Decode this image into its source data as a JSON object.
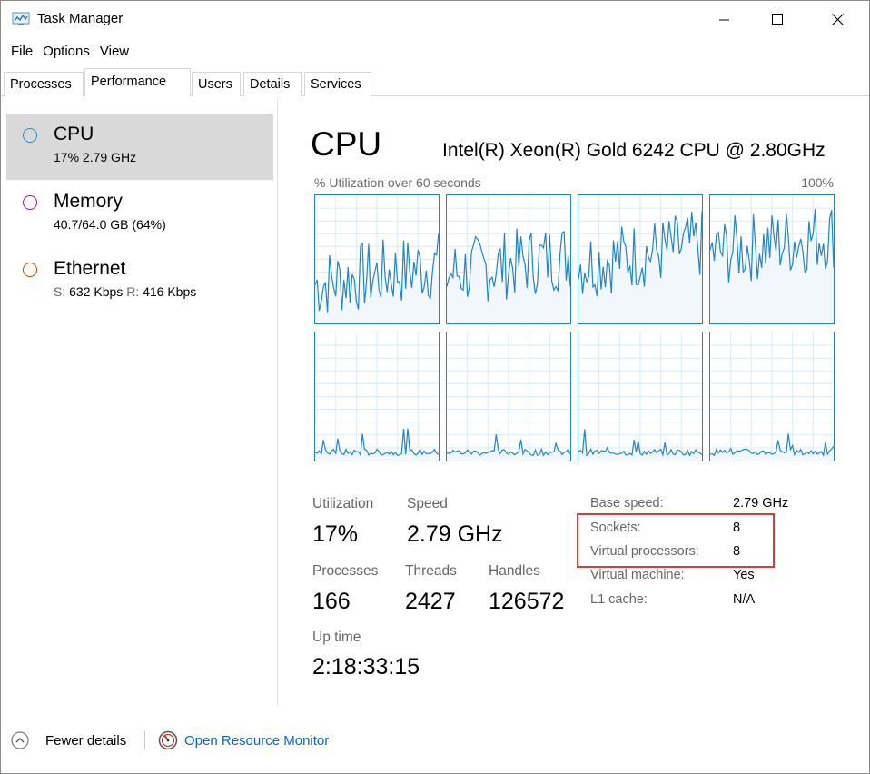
{
  "window": {
    "title": "Task Manager",
    "icon": "task-manager-icon"
  },
  "menu": [
    "File",
    "Options",
    "View"
  ],
  "tabs": [
    {
      "label": "Processes",
      "active": false
    },
    {
      "label": "Performance",
      "active": true
    },
    {
      "label": "Users",
      "active": false
    },
    {
      "label": "Details",
      "active": false
    },
    {
      "label": "Services",
      "active": false
    }
  ],
  "sidebar": {
    "items": [
      {
        "title": "CPU",
        "subtitle": "17% 2.79 GHz",
        "color": "#1b8dd8",
        "selected": true
      },
      {
        "title": "Memory",
        "subtitle": "40.7/64.0 GB (64%)",
        "color": "#8b12ae",
        "selected": false
      },
      {
        "title": "Ethernet",
        "sub_s_label": "S:",
        "sub_s_value": "632 Kbps",
        "sub_r_label": "R:",
        "sub_r_value": "416 Kbps",
        "color": "#a74f01",
        "selected": false
      }
    ]
  },
  "cpu": {
    "title": "CPU",
    "model": "Intel(R) Xeon(R) Gold 6242 CPU @ 2.80GHz",
    "graph_label": "% Utilization over 60 seconds",
    "graph_max": "100%",
    "graph_color": "#1f85c6",
    "stats": {
      "utilization_label": "Utilization",
      "utilization": "17%",
      "speed_label": "Speed",
      "speed": "2.79 GHz",
      "processes_label": "Processes",
      "processes": "166",
      "threads_label": "Threads",
      "threads": "2427",
      "handles_label": "Handles",
      "handles": "126572",
      "uptime_label": "Up time",
      "uptime": "2:18:33:15"
    },
    "details": [
      {
        "label": "Base speed:",
        "value": "2.79 GHz"
      },
      {
        "label": "Sockets:",
        "value": "8"
      },
      {
        "label": "Virtual processors:",
        "value": "8"
      },
      {
        "label": "Virtual machine:",
        "value": "Yes"
      },
      {
        "label": "L1 cache:",
        "value": "N/A"
      }
    ],
    "highlight_color": "#e0383e"
  },
  "footer": {
    "fewer_details": "Fewer details",
    "open_resource_monitor": "Open Resource Monitor",
    "link_color": "#0a66c2"
  }
}
